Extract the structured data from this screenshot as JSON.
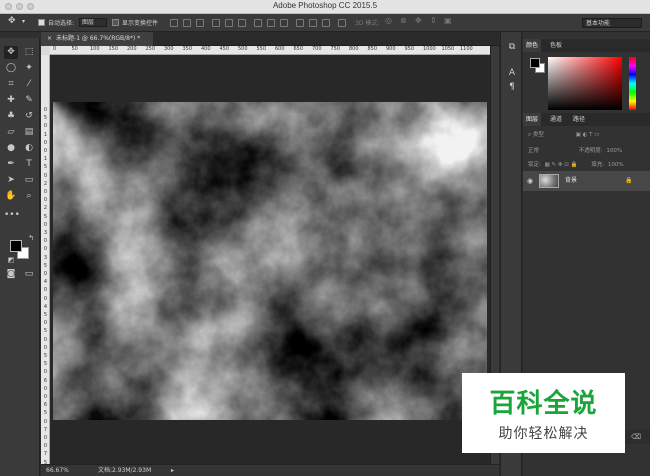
{
  "window": {
    "title": "Adobe Photoshop CC 2015.5"
  },
  "options_bar": {
    "auto_select_label": "自动选择:",
    "auto_select_value": "图层",
    "show_transform_label": "显示变换控件",
    "mode3d_label": "3D 模式:",
    "workspace": "基本功能"
  },
  "document": {
    "tab_title": "未标题-1 @ 66.7%(RGB/8*) *"
  },
  "ruler": {
    "h_ticks": [
      "0",
      "50",
      "100",
      "150",
      "200",
      "250",
      "300",
      "350",
      "400",
      "450",
      "500",
      "550",
      "600",
      "650",
      "700",
      "750",
      "800",
      "850",
      "900",
      "950",
      "1000",
      "1050",
      "1100"
    ],
    "v_ticks": [
      "0",
      "5",
      "0",
      "1",
      "0",
      "0",
      "1",
      "5",
      "0",
      "2",
      "0",
      "0",
      "2",
      "5",
      "0",
      "3",
      "0",
      "0",
      "3",
      "5",
      "0",
      "4",
      "0",
      "0",
      "4",
      "5",
      "0",
      "5",
      "0",
      "0",
      "5",
      "5",
      "0",
      "6",
      "0",
      "0",
      "6",
      "5",
      "0",
      "7",
      "0",
      "0",
      "7",
      "5",
      "0"
    ]
  },
  "status": {
    "zoom": "66.67%",
    "doc_size": "文档:2.93M/2.93M"
  },
  "panels": {
    "color_tabs": [
      "颜色",
      "色板"
    ],
    "layer_tabs": [
      "图层",
      "通道",
      "路径"
    ],
    "filter_kind": "类型",
    "blend_mode": "正常",
    "opacity_label": "不透明度:",
    "opacity_value": "100%",
    "lock_label": "锁定:",
    "fill_label": "填充:",
    "fill_value": "100%",
    "layer_name": "背景"
  },
  "watermark": {
    "title": "百科全说",
    "subtitle": "助你轻松解决"
  },
  "colors": {
    "picker_hue": "#ff0000",
    "foreground": "#000000",
    "background": "#ffffff",
    "watermark_green": "#1aa53b"
  }
}
